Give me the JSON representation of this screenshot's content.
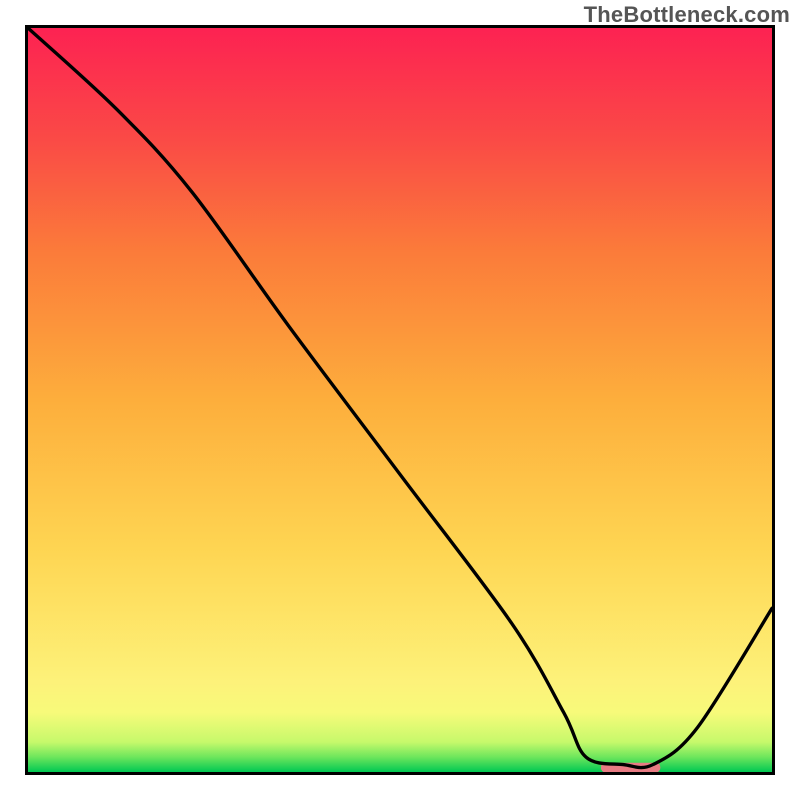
{
  "watermark": "TheBottleneck.com",
  "chart_data": {
    "type": "line",
    "title": "",
    "xlabel": "",
    "ylabel": "",
    "xlim": [
      0,
      100
    ],
    "ylim": [
      0,
      100
    ],
    "grid": false,
    "background": "rainbow-vertical",
    "series": [
      {
        "name": "curve",
        "x": [
          0,
          12,
          22,
          35,
          50,
          65,
          72,
          75,
          80,
          84,
          90,
          100
        ],
        "y": [
          100,
          89,
          78,
          60,
          40,
          20,
          8,
          2,
          1,
          1,
          6,
          22
        ]
      }
    ],
    "marker": {
      "name": "minimum-marker",
      "x_center": 81,
      "y": 0.6,
      "width_pct": 8,
      "color": "#e87b83"
    },
    "gradient_stops": [
      {
        "offset": 0.0,
        "color": "#00c853"
      },
      {
        "offset": 0.02,
        "color": "#6de65c"
      },
      {
        "offset": 0.04,
        "color": "#c6f96b"
      },
      {
        "offset": 0.08,
        "color": "#f7fa7a"
      },
      {
        "offset": 0.12,
        "color": "#fdf27a"
      },
      {
        "offset": 0.3,
        "color": "#fed552"
      },
      {
        "offset": 0.5,
        "color": "#fdae3c"
      },
      {
        "offset": 0.7,
        "color": "#fb7b3a"
      },
      {
        "offset": 0.85,
        "color": "#fa4a46"
      },
      {
        "offset": 1.0,
        "color": "#fd2252"
      }
    ]
  }
}
